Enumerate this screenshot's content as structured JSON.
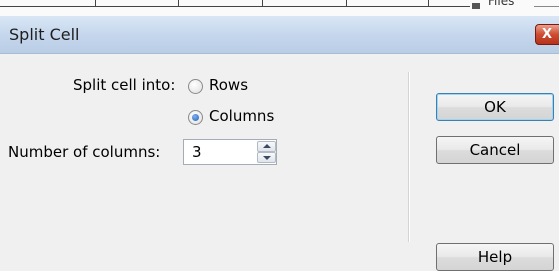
{
  "background": {
    "partial_label": "Files"
  },
  "dialog": {
    "title": "Split Cell",
    "close_glyph": "X",
    "split_label": "Split cell into:",
    "options": [
      {
        "label": "Rows",
        "checked": false
      },
      {
        "label": "Columns",
        "checked": true
      }
    ],
    "count_label": "Number of columns:",
    "count_value": "3",
    "buttons": {
      "ok": "OK",
      "cancel": "Cancel",
      "help": "Help"
    }
  },
  "colors": {
    "titlebar": "#c4d6ec",
    "close_button": "#cf4b30",
    "default_button_border": "#3c7fb1",
    "dialog_body": "#f0f0f0"
  },
  "icons": [
    "close-icon",
    "spin-up-icon",
    "spin-down-icon"
  ]
}
